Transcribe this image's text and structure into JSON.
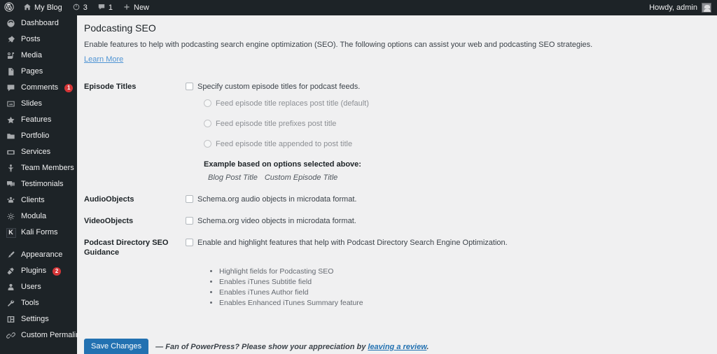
{
  "adminbar": {
    "logo_icon": "wordpress-logo-icon",
    "site": {
      "label": "My Blog",
      "icon": "home-icon"
    },
    "updates": {
      "label": "3",
      "icon": "updates-icon"
    },
    "comments": {
      "label": "1",
      "icon": "comment-bubble-icon"
    },
    "new": {
      "label": "New",
      "icon": "plus-icon"
    },
    "account": {
      "label": "Howdy, admin",
      "icon": "avatar-icon"
    }
  },
  "sidebar": {
    "items": [
      {
        "label": "Dashboard",
        "icon": "dashboard-icon",
        "badge": null,
        "sep_after": false
      },
      {
        "label": "Posts",
        "icon": "pin-icon",
        "badge": null,
        "sep_after": false
      },
      {
        "label": "Media",
        "icon": "media-icon",
        "badge": null,
        "sep_after": false
      },
      {
        "label": "Pages",
        "icon": "page-icon",
        "badge": null,
        "sep_after": false
      },
      {
        "label": "Comments",
        "icon": "comment-icon",
        "badge": "1",
        "sep_after": false
      },
      {
        "label": "Slides",
        "icon": "slides-icon",
        "badge": null,
        "sep_after": false
      },
      {
        "label": "Features",
        "icon": "star-icon",
        "badge": null,
        "sep_after": false
      },
      {
        "label": "Portfolio",
        "icon": "portfolio-icon",
        "badge": null,
        "sep_after": false
      },
      {
        "label": "Services",
        "icon": "services-icon",
        "badge": null,
        "sep_after": false
      },
      {
        "label": "Team Members",
        "icon": "person-icon",
        "badge": null,
        "sep_after": false
      },
      {
        "label": "Testimonials",
        "icon": "testimonial-icon",
        "badge": null,
        "sep_after": false
      },
      {
        "label": "Clients",
        "icon": "clients-icon",
        "badge": null,
        "sep_after": false
      },
      {
        "label": "Modula",
        "icon": "modula-icon",
        "badge": null,
        "sep_after": false
      },
      {
        "label": "Kali Forms",
        "icon": "kali-forms-icon",
        "badge": null,
        "sep_after": true
      },
      {
        "label": "Appearance",
        "icon": "brush-icon",
        "badge": null,
        "sep_after": false
      },
      {
        "label": "Plugins",
        "icon": "plugin-icon",
        "badge": "2",
        "sep_after": false
      },
      {
        "label": "Users",
        "icon": "user-icon",
        "badge": null,
        "sep_after": false
      },
      {
        "label": "Tools",
        "icon": "wrench-icon",
        "badge": null,
        "sep_after": false
      },
      {
        "label": "Settings",
        "icon": "settings-icon",
        "badge": null,
        "sep_after": false
      },
      {
        "label": "Custom Permalinks",
        "icon": "link-icon",
        "badge": null,
        "sep_after": false
      }
    ]
  },
  "page": {
    "title": "Podcasting SEO",
    "description": "Enable features to help with podcasting search engine optimization (SEO). The following options can assist your web and podcasting SEO strategies.",
    "learn_more": "Learn More"
  },
  "form": {
    "rows": [
      {
        "label": "Episode Titles",
        "checkbox_label": "Specify custom episode titles for podcast feeds.",
        "checked": false
      },
      {
        "label": "AudioObjects",
        "checkbox_label": "Schema.org audio objects in microdata format.",
        "checked": false
      },
      {
        "label": "VideoObjects",
        "checkbox_label": "Schema.org video objects in microdata format.",
        "checked": false
      },
      {
        "label": "Podcast Directory SEO Guidance",
        "checkbox_label": "Enable and highlight features that help with Podcast Directory Search Engine Optimization.",
        "checked": false
      }
    ],
    "episode_title_radios": [
      {
        "label": "Feed episode title replaces post title (default)",
        "selected": false
      },
      {
        "label": "Feed episode title prefixes post title",
        "selected": false
      },
      {
        "label": "Feed episode title appended to post title",
        "selected": false
      }
    ],
    "example": {
      "heading": "Example based on options selected above:",
      "part_one": "Blog Post Title",
      "part_two": "Custom Episode Title"
    },
    "seo_guidance_features": [
      "Highlight fields for Podcasting SEO",
      "Enables iTunes Subtitle field",
      "Enables iTunes Author field",
      "Enables Enhanced iTunes Summary feature"
    ]
  },
  "footer": {
    "save_label": "Save Changes",
    "review_prefix": "— Fan of PowerPress? Please show your appreciation by ",
    "review_link": "leaving a review",
    "review_suffix": "."
  },
  "colors": {
    "admin_bar": "#1d2327",
    "sidebar": "#1d2327",
    "content_bg": "#f0f0f1",
    "accent_blue": "#2271b1",
    "link_blue": "#4f94d4",
    "badge_red": "#d63638"
  }
}
